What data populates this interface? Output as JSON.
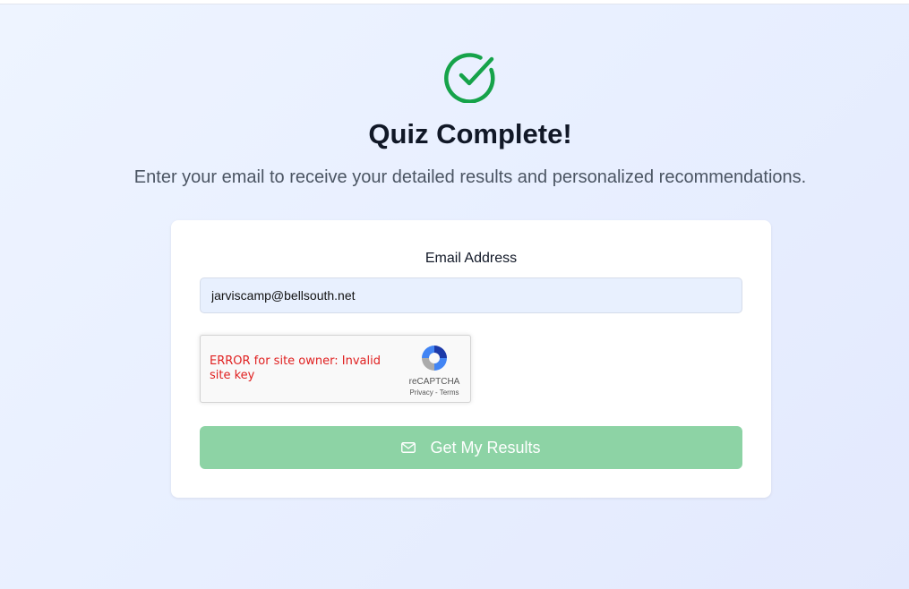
{
  "header": {
    "icon": "check-circle-icon",
    "title": "Quiz Complete!",
    "subtitle": "Enter your email to receive your detailed results and personalized recommendations."
  },
  "form": {
    "email_label": "Email Address",
    "email_value": "jarviscamp@bellsouth.net",
    "recaptcha": {
      "error_text": "ERROR for site owner: Invalid site key",
      "brand": "reCAPTCHA",
      "privacy_label": "Privacy",
      "separator": " - ",
      "terms_label": "Terms"
    },
    "submit": {
      "icon": "mail-icon",
      "label": "Get My Results",
      "disabled": true
    }
  },
  "colors": {
    "success_green": "#16a34a",
    "button_green_disabled": "#8dd3a5",
    "error_red": "#e02020"
  }
}
